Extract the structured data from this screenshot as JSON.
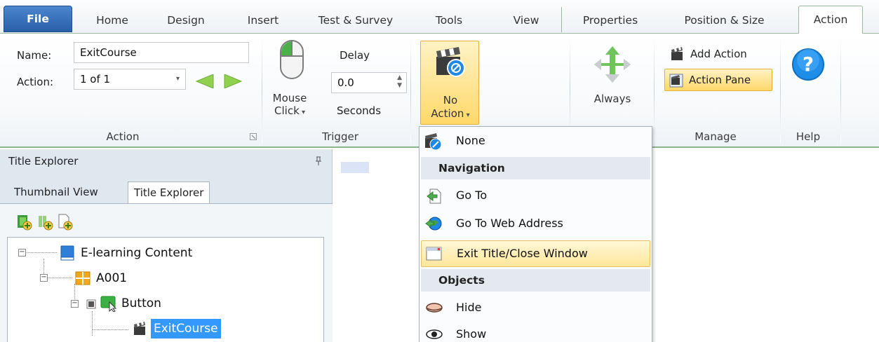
{
  "tabs": {
    "file": "File",
    "home": "Home",
    "design": "Design",
    "insert": "Insert",
    "test_survey": "Test & Survey",
    "tools": "Tools",
    "view": "View",
    "properties": "Properties",
    "position_size": "Position & Size",
    "action": "Action"
  },
  "ribbon": {
    "action_group": {
      "name_label": "Name:",
      "name_value": "ExitCourse",
      "action_label": "Action:",
      "action_value": "1 of 1",
      "group_label": "Action"
    },
    "trigger_group": {
      "mouse_click": "Mouse",
      "mouse_click2": "Click",
      "delay_label": "Delay",
      "delay_value": "0.0",
      "seconds_label": "Seconds",
      "group_label": "Trigger"
    },
    "no_action": {
      "line1": "No",
      "line2": "Action"
    },
    "always": {
      "label": "Always"
    },
    "manage_group": {
      "add_action": "Add Action",
      "action_pane": "Action Pane",
      "group_label": "Manage"
    },
    "help_group": {
      "group_label": "Help"
    }
  },
  "explorer": {
    "title": "Title Explorer",
    "tabs": {
      "thumbnail": "Thumbnail View",
      "title_explorer": "Title Explorer"
    },
    "tree": {
      "root": "E-learning Content",
      "chapter": "A001",
      "button": "Button",
      "action": "ExitCourse"
    }
  },
  "menu": {
    "none": "None",
    "nav_header": "Navigation",
    "goto": "Go To",
    "goto_web": "Go To Web Address",
    "exit_title": "Exit Title/Close Window",
    "objects_header": "Objects",
    "hide": "Hide",
    "show": "Show"
  },
  "colors": {
    "accent": "#2a5ea8",
    "ribbon_green": "#8cb58a",
    "highlight": "#ffd86a",
    "selection": "#3399ff"
  }
}
